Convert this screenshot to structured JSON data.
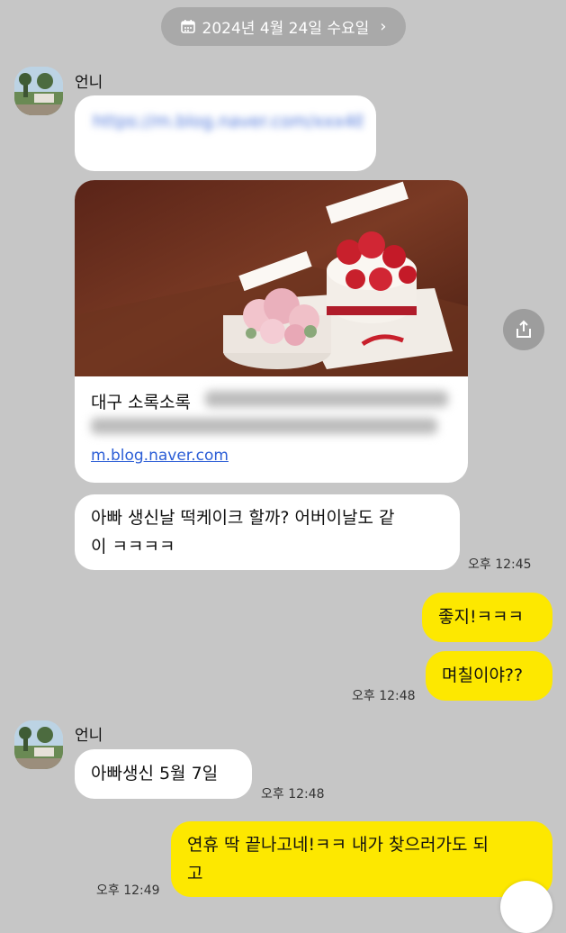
{
  "date_divider": {
    "label": "2024년 4월 24일 수요일",
    "chevron": "›"
  },
  "sender": {
    "name": "언니"
  },
  "messages": {
    "link_text": "https://m.blog.naver.com/xxx48200123462827363",
    "card": {
      "title": "대구 소록소록",
      "domain": "m.blog.naver.com"
    },
    "m1": {
      "line1": "아빠 생신날 떡케이크 할까? 어버이날도 같",
      "line2": "이 ㅋㅋㅋㅋ",
      "time": "오후 12:45"
    },
    "m2": {
      "text": "좋지!ㅋㅋㅋ"
    },
    "m3": {
      "text": "며칠이야??",
      "time": "오후 12:48"
    },
    "m4": {
      "text": "아빠생신 5월 7일",
      "time": "오후 12:48"
    },
    "m5": {
      "line1": "연휴 딱 끝나고네!ㅋㅋ 내가 찾으러가도 되",
      "line2": "고",
      "time": "오후 12:49"
    }
  },
  "icons": {
    "calendar": "calendar-icon",
    "share": "share-icon",
    "avatar": "avatar-image"
  },
  "colors": {
    "background": "#c6c6c6",
    "my_bubble": "#fde800",
    "their_bubble": "#ffffff",
    "link": "#2c5ed6"
  }
}
